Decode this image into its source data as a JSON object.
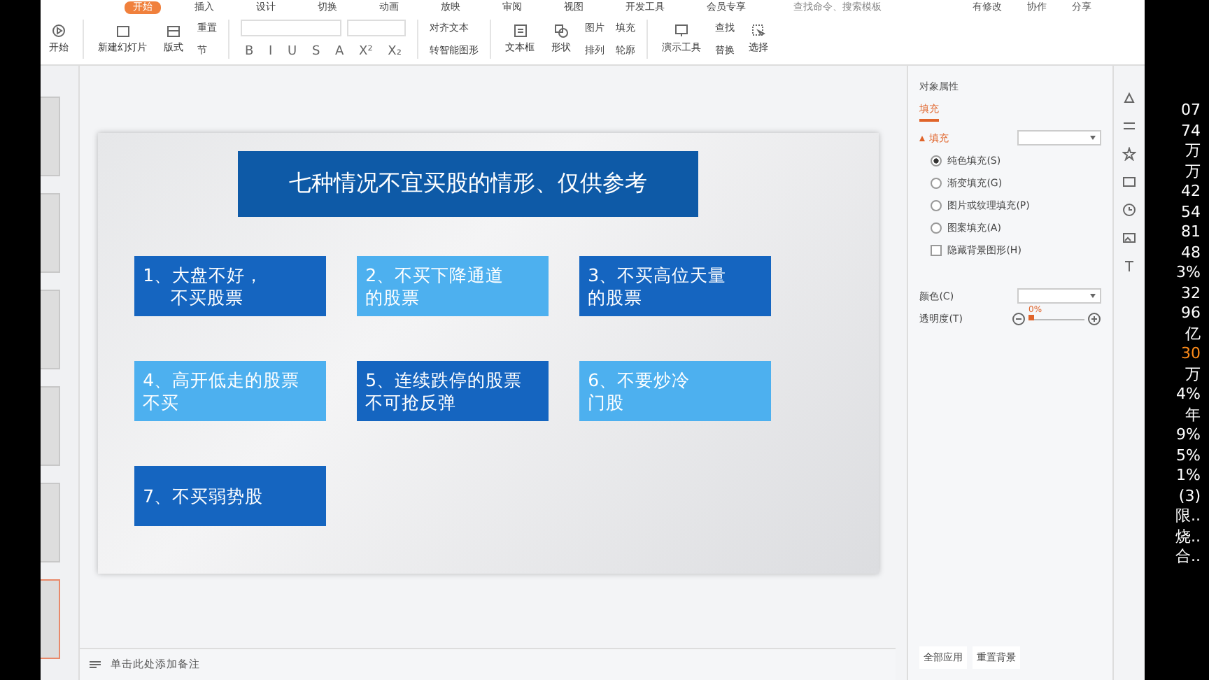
{
  "menu_tabs": [
    {
      "label": "开始",
      "selected": true
    },
    {
      "label": "插入",
      "selected": false
    },
    {
      "label": "设计",
      "selected": false
    },
    {
      "label": "切换",
      "selected": false
    },
    {
      "label": "动画",
      "selected": false
    },
    {
      "label": "放映",
      "selected": false
    },
    {
      "label": "审阅",
      "selected": false
    },
    {
      "label": "视图",
      "selected": false
    },
    {
      "label": "开发工具",
      "selected": false
    },
    {
      "label": "会员专享",
      "selected": false
    }
  ],
  "search": {
    "placeholder": "查找命令、搜索模板"
  },
  "top_right": [
    "有修改",
    "协作",
    "分享"
  ],
  "toolbar": {
    "play": "开始",
    "new_slide": "新建幻灯片",
    "layout": "版式",
    "reset": "重置",
    "section": "节",
    "format_glyphs": [
      "B",
      "I",
      "U",
      "S",
      "A",
      "X²",
      "X₂"
    ],
    "align_text": "对齐文本",
    "smart_art": "转智能图形",
    "text_box": "文本框",
    "shape": "形状",
    "picture": "图片",
    "arrange": "排列",
    "fill": "填充",
    "outline": "轮廓",
    "present_tools": "演示工具",
    "find": "查找",
    "replace": "替换",
    "select": "选择"
  },
  "thumbnails": [
    {
      "selected": false
    },
    {
      "selected": false
    },
    {
      "selected": false
    },
    {
      "selected": false
    },
    {
      "selected": false
    },
    {
      "selected": true
    }
  ],
  "slide": {
    "title": "七种情况不宜买股的情形、仅供参考",
    "boxes": [
      {
        "lines": [
          "1、大盘不好，",
          "不买股票"
        ],
        "color": "#1565c0"
      },
      {
        "lines": [
          "2、不买下降通道",
          "的股票"
        ],
        "color": "#4db0ef"
      },
      {
        "lines": [
          "3、不买高位天量",
          "的股票"
        ],
        "color": "#1565c0"
      },
      {
        "lines": [
          "4、高开低走的股票",
          "不买"
        ],
        "color": "#4db0ef"
      },
      {
        "lines": [
          "5、连续跌停的股票",
          "不可抢反弹"
        ],
        "color": "#1565c0"
      },
      {
        "lines": [
          "6、不要炒冷",
          "门股"
        ],
        "color": "#4db0ef"
      },
      {
        "lines": [
          "7、不买弱势股"
        ],
        "color": "#1565c0"
      }
    ]
  },
  "notes": {
    "placeholder": "单击此处添加备注"
  },
  "panel": {
    "title": "对象属性",
    "tabs": [
      {
        "label": "填充",
        "selected": true
      }
    ],
    "section": "填充",
    "options": [
      {
        "kind": "radio",
        "label": "纯色填充(S)",
        "selected": true
      },
      {
        "kind": "radio",
        "label": "渐变填充(G)",
        "selected": false
      },
      {
        "kind": "radio",
        "label": "图片或纹理填充(P)",
        "selected": false
      },
      {
        "kind": "radio",
        "label": "图案填充(A)",
        "selected": false
      },
      {
        "kind": "checkbox",
        "label": "隐藏背景图形(H)",
        "checked": false
      }
    ],
    "color_label": "颜色(C)",
    "transparency_label": "透明度(T)",
    "transparency": {
      "reading": "0%",
      "level": 0
    },
    "buttons": [
      "全部应用",
      "重置背景"
    ]
  },
  "side_strip": [
    {
      "text": "07",
      "color": "#ffffff"
    },
    {
      "text": "74",
      "color": "#ffffff"
    },
    {
      "text": "万",
      "color": "#ffffff"
    },
    {
      "text": "万",
      "color": "#ffffff"
    },
    {
      "text": "42",
      "color": "#ffffff"
    },
    {
      "text": "54",
      "color": "#ffffff"
    },
    {
      "text": "81",
      "color": "#ffffff"
    },
    {
      "text": "48",
      "color": "#ffffff"
    },
    {
      "text": "3%",
      "color": "#ffffff"
    },
    {
      "text": "32",
      "color": "#ffffff"
    },
    {
      "text": "96",
      "color": "#ffffff"
    },
    {
      "text": "亿",
      "color": "#ffffff"
    },
    {
      "text": "30",
      "color": "#ff8c1a"
    },
    {
      "text": "万",
      "color": "#ffffff"
    },
    {
      "text": "4%",
      "color": "#ffffff"
    },
    {
      "text": "年",
      "color": "#ffffff"
    },
    {
      "text": "9%",
      "color": "#ffffff"
    },
    {
      "text": "5%",
      "color": "#ffffff"
    },
    {
      "text": "1%",
      "color": "#ffffff"
    },
    {
      "text": "(3)",
      "color": "#ffffff"
    },
    {
      "text": "限..",
      "color": "#ffffff"
    },
    {
      "text": "烧..",
      "color": "#ffffff"
    },
    {
      "text": "合..",
      "color": "#ffffff"
    }
  ]
}
